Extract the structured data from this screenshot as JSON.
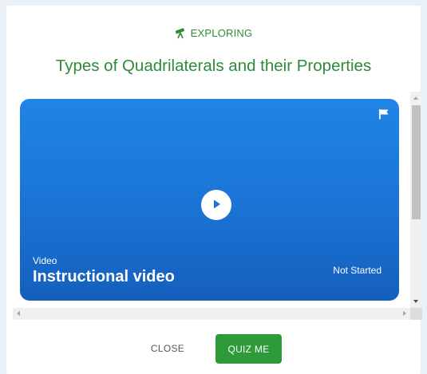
{
  "header": {
    "eyebrow_icon": "telescope-icon",
    "eyebrow_label": "EXPLORING",
    "title": "Types of Quadrilaterals and their Properties"
  },
  "card": {
    "type_label": "Video",
    "title": "Instructional video",
    "status": "Not Started",
    "flag_icon": "flag-icon",
    "play_icon": "play-icon"
  },
  "actions": {
    "close_label": "CLOSE",
    "quiz_label": "QUIZ ME"
  },
  "colors": {
    "accent_green": "#2e8b3a",
    "button_green": "#2e9b3b",
    "card_blue": "#1a73d4",
    "page_bg": "#e9f0f7"
  }
}
